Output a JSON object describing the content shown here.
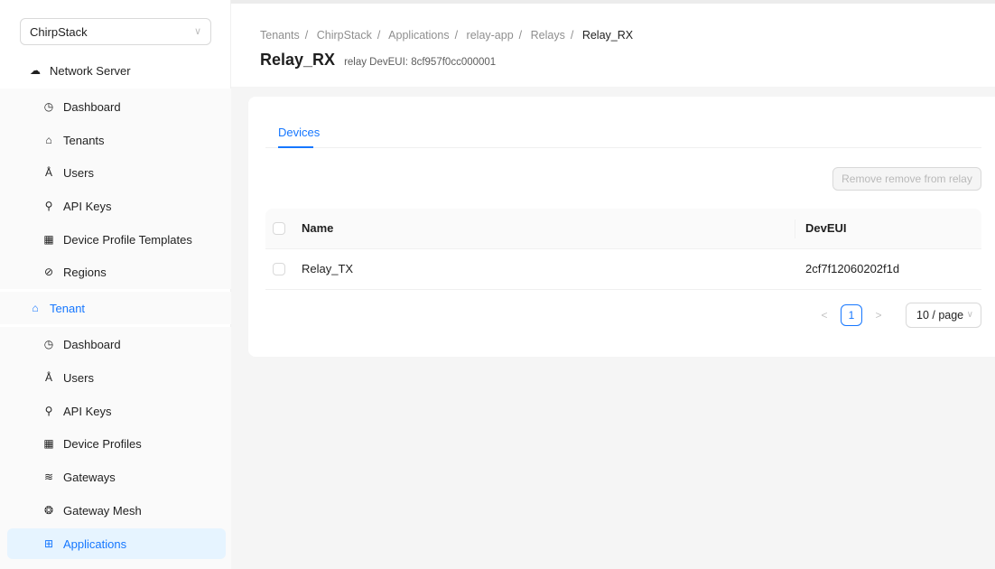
{
  "sidebar": {
    "tenant_select": {
      "value": "ChirpStack"
    },
    "network_server": {
      "label": "Network Server",
      "icon": "cloud-icon"
    },
    "ns_items": [
      {
        "label": "Dashboard",
        "icon": "dashboard-icon"
      },
      {
        "label": "Tenants",
        "icon": "home-icon"
      },
      {
        "label": "Users",
        "icon": "user-icon"
      },
      {
        "label": "API Keys",
        "icon": "key-icon"
      },
      {
        "label": "Device Profile Templates",
        "icon": "profile-icon"
      },
      {
        "label": "Regions",
        "icon": "compass-icon"
      }
    ],
    "tenant": {
      "label": "Tenant",
      "icon": "home-icon"
    },
    "tenant_items": [
      {
        "label": "Dashboard",
        "icon": "dashboard-icon"
      },
      {
        "label": "Users",
        "icon": "user-icon"
      },
      {
        "label": "API Keys",
        "icon": "key-icon"
      },
      {
        "label": "Device Profiles",
        "icon": "profile-icon"
      },
      {
        "label": "Gateways",
        "icon": "wifi-icon"
      },
      {
        "label": "Gateway Mesh",
        "icon": "radar-icon"
      },
      {
        "label": "Applications",
        "icon": "appstore-icon"
      }
    ]
  },
  "breadcrumb": [
    "Tenants",
    "ChirpStack",
    "Applications",
    "relay-app",
    "Relays",
    "Relay_RX"
  ],
  "page": {
    "title": "Relay_RX",
    "subtitle": "relay DevEUI: 8cf957f0cc000001"
  },
  "tabs": [
    {
      "label": "Devices"
    }
  ],
  "actions": {
    "remove_label": "Remove remove from relay"
  },
  "table": {
    "columns": [
      "Name",
      "DevEUI"
    ],
    "rows": [
      {
        "name": "Relay_TX",
        "dev_eui": "2cf7f12060202f1d"
      }
    ]
  },
  "pagination": {
    "prev": "<",
    "current": "1",
    "next": ">",
    "page_size": "10 / page"
  },
  "colors": {
    "accent": "#1677ff",
    "active_bg": "#e6f4ff"
  }
}
